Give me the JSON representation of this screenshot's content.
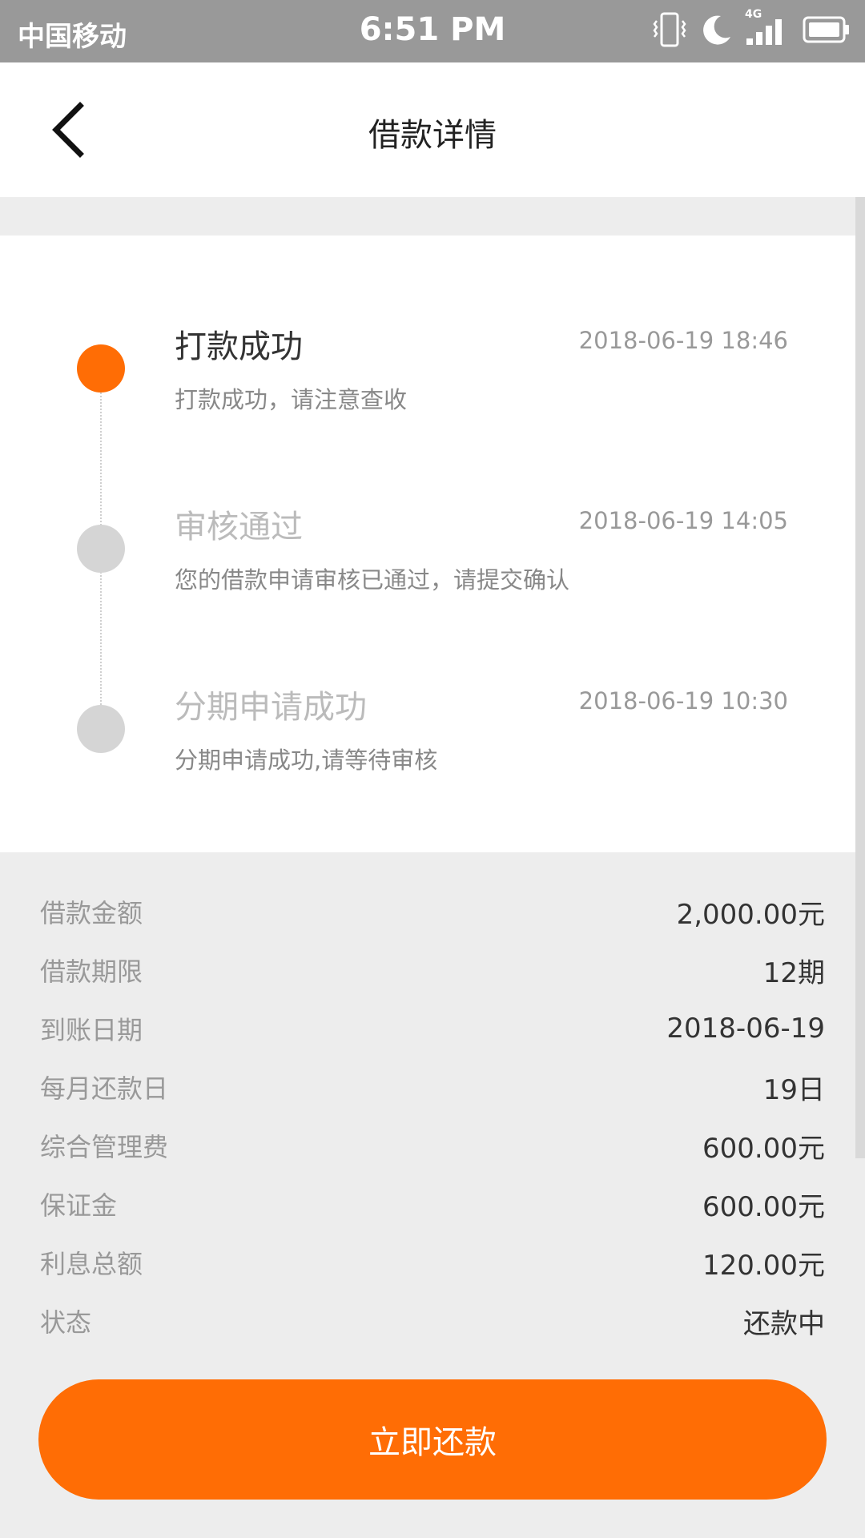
{
  "status_bar": {
    "carrier": "中国移动",
    "time": "6:51 PM",
    "network": "4G"
  },
  "nav": {
    "title": "借款详情"
  },
  "timeline": [
    {
      "title": "打款成功",
      "time": "2018-06-19 18:46",
      "desc": "打款成功，请注意查收",
      "active": true
    },
    {
      "title": "审核通过",
      "time": "2018-06-19 14:05",
      "desc": "您的借款申请审核已通过，请提交确认",
      "active": false
    },
    {
      "title": "分期申请成功",
      "time": "2018-06-19 10:30",
      "desc": "分期申请成功,请等待审核",
      "active": false
    }
  ],
  "details": [
    {
      "label": "借款金额",
      "value": "2,000.00元"
    },
    {
      "label": "借款期限",
      "value": "12期"
    },
    {
      "label": "到账日期",
      "value": "2018-06-19"
    },
    {
      "label": "每月还款日",
      "value": "19日"
    },
    {
      "label": "综合管理费",
      "value": "600.00元"
    },
    {
      "label": "保证金",
      "value": "600.00元"
    },
    {
      "label": "利息总额",
      "value": "120.00元"
    },
    {
      "label": "状态",
      "value": "还款中"
    }
  ],
  "action": {
    "repay_label": "立即还款"
  },
  "colors": {
    "accent": "#ff6d05",
    "inactive_dot": "#d5d5d5",
    "page_background": "#ededed"
  }
}
